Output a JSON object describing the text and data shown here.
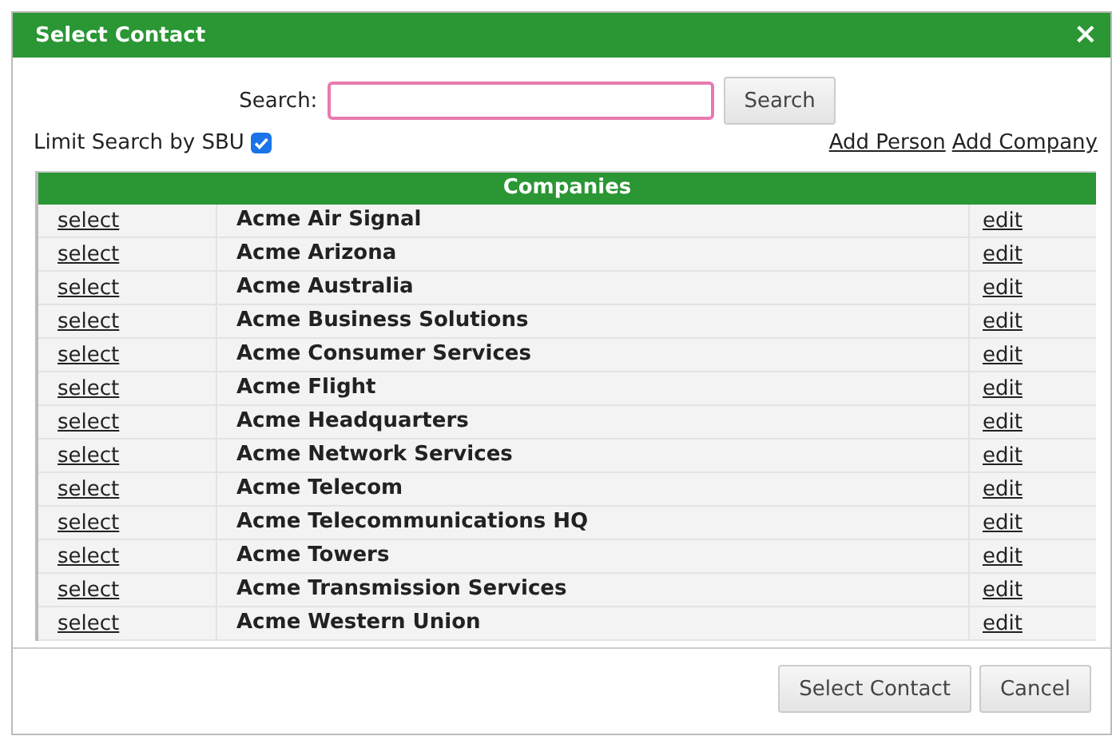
{
  "window": {
    "title": "Select Contact",
    "close": "×"
  },
  "search": {
    "label": "Search:",
    "focused": true,
    "button": "Search"
  },
  "limit": {
    "label": "Limit Search by SBU",
    "checked": true
  },
  "links": [
    "Add Person",
    "Add Company"
  ],
  "table": {
    "title": "Companies",
    "rows": [
      {
        "select": "select",
        "name": "Acme Air Signal",
        "edit": "edit"
      },
      {
        "select": "select",
        "name": "Acme Arizona",
        "edit": "edit"
      },
      {
        "select": "select",
        "name": "Acme Australia",
        "edit": "edit"
      },
      {
        "select": "select",
        "name": "Acme Business Solutions",
        "edit": "edit"
      },
      {
        "select": "select",
        "name": "Acme Consumer Services",
        "edit": "edit"
      },
      {
        "select": "select",
        "name": "Acme Flight",
        "edit": "edit"
      },
      {
        "select": "select",
        "name": "Acme Headquarters",
        "edit": "edit"
      },
      {
        "select": "select",
        "name": "Acme Network Services",
        "edit": "edit"
      },
      {
        "select": "select",
        "name": "Acme Telecom",
        "edit": "edit"
      },
      {
        "select": "select",
        "name": "Acme Telecommunications HQ",
        "edit": "edit"
      },
      {
        "select": "select",
        "name": "Acme Towers",
        "edit": "edit"
      },
      {
        "select": "select",
        "name": "Acme Transmission Services",
        "edit": "edit"
      },
      {
        "select": "select",
        "name": "Acme Western Union",
        "edit": "edit"
      }
    ]
  },
  "buttons": [
    "Select Contact",
    "Cancel"
  ]
}
